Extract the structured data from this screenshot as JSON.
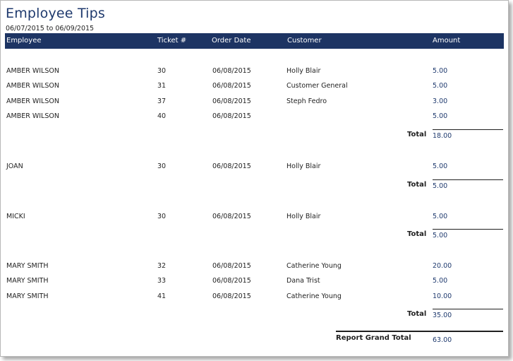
{
  "report": {
    "title": "Employee Tips",
    "date_range": "06/07/2015 to 06/09/2015"
  },
  "columns": {
    "employee": "Employee",
    "ticket": "Ticket #",
    "order_date": "Order Date",
    "customer": "Customer",
    "amount": "Amount"
  },
  "groups": [
    {
      "rows": [
        {
          "employee": "AMBER WILSON",
          "ticket": "30",
          "order_date": "06/08/2015",
          "customer": "Holly Blair",
          "amount": "5.00"
        },
        {
          "employee": "AMBER WILSON",
          "ticket": "31",
          "order_date": "06/08/2015",
          "customer": "Customer General",
          "amount": "5.00"
        },
        {
          "employee": "AMBER WILSON",
          "ticket": "37",
          "order_date": "06/08/2015",
          "customer": "Steph Fedro",
          "amount": "3.00"
        },
        {
          "employee": "AMBER WILSON",
          "ticket": "40",
          "order_date": "06/08/2015",
          "customer": "",
          "amount": "5.00"
        }
      ],
      "total_label": "Total",
      "total": "18.00"
    },
    {
      "rows": [
        {
          "employee": "JOAN",
          "ticket": "30",
          "order_date": "06/08/2015",
          "customer": "Holly Blair",
          "amount": "5.00"
        }
      ],
      "total_label": "Total",
      "total": "5.00"
    },
    {
      "rows": [
        {
          "employee": "MICKI",
          "ticket": "30",
          "order_date": "06/08/2015",
          "customer": "Holly Blair",
          "amount": "5.00"
        }
      ],
      "total_label": "Total",
      "total": "5.00"
    },
    {
      "rows": [
        {
          "employee": "MARY SMITH",
          "ticket": "32",
          "order_date": "06/08/2015",
          "customer": "Catherine Young",
          "amount": "20.00"
        },
        {
          "employee": "MARY SMITH",
          "ticket": "33",
          "order_date": "06/08/2015",
          "customer": "Dana Trist",
          "amount": "5.00"
        },
        {
          "employee": "MARY SMITH",
          "ticket": "41",
          "order_date": "06/08/2015",
          "customer": "Catherine Young",
          "amount": "10.00"
        }
      ],
      "total_label": "Total",
      "total": "35.00"
    }
  ],
  "grand_total": {
    "label": "Report Grand Total",
    "value": "63.00"
  }
}
